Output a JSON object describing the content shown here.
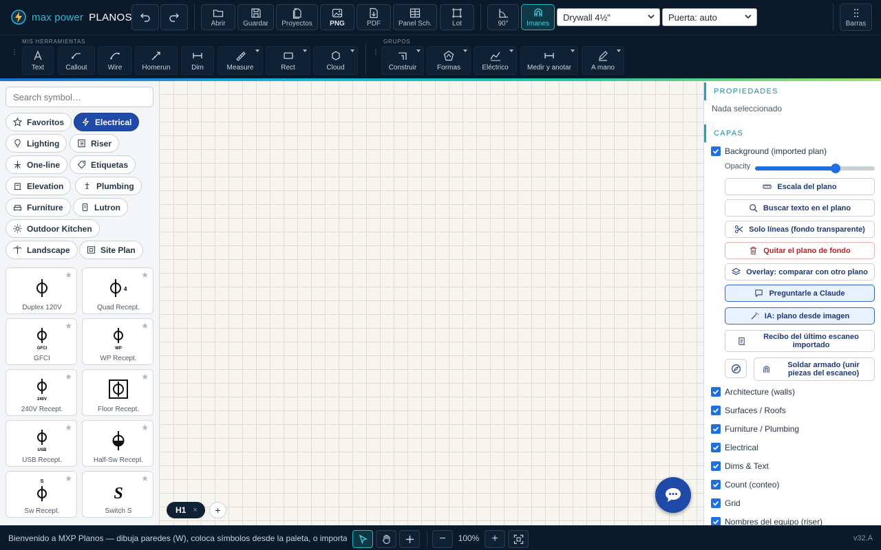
{
  "app": {
    "brand_primary": "max power",
    "brand_secondary": "PLANOS",
    "accent_color": "#1aa6bd",
    "primary_button_color": "#1f4aa8"
  },
  "topbar": {
    "undo_icon": "undo-icon",
    "redo_icon": "redo-icon",
    "file_buttons": [
      {
        "label": "Abrir",
        "icon": "folder-open-icon"
      },
      {
        "label": "Guardar",
        "icon": "save-icon"
      },
      {
        "label": "Proyectos",
        "icon": "projects-icon"
      },
      {
        "label": "PNG",
        "icon": "image-icon"
      },
      {
        "label": "PDF",
        "icon": "pdf-icon"
      },
      {
        "label": "Panel Sch.",
        "icon": "table-icon"
      },
      {
        "label": "Lot",
        "icon": "lot-icon"
      }
    ],
    "angle_button": {
      "label": "90°",
      "icon": "angle-icon"
    },
    "magnet_button": {
      "label": "Imanes",
      "icon": "magnet-icon",
      "active": true
    },
    "wall_type_select": "Drywall 4½\"",
    "door_select": "Puerta: auto",
    "toolbars_button": {
      "label": "Barras",
      "icon": "more-vertical-icon"
    }
  },
  "toolbar": {
    "my_tools_title": "MIS HERRAMIENTAS",
    "groups_title": "GRUPOS",
    "my_tools": [
      {
        "label": "Text",
        "icon": "text-icon",
        "dropdown": false
      },
      {
        "label": "Callout",
        "icon": "callout-icon",
        "dropdown": false
      },
      {
        "label": "Wire",
        "icon": "wire-icon",
        "dropdown": false
      },
      {
        "label": "Homerun",
        "icon": "homerun-icon",
        "dropdown": false
      },
      {
        "label": "Dim",
        "icon": "dimension-icon",
        "dropdown": false
      },
      {
        "label": "Measure",
        "icon": "measure-icon",
        "dropdown": true
      },
      {
        "label": "Rect",
        "icon": "rectangle-icon",
        "dropdown": true
      },
      {
        "label": "Cloud",
        "icon": "cloud-icon",
        "dropdown": true
      }
    ],
    "groups": [
      {
        "label": "Construir",
        "icon": "construct-icon",
        "dropdown": true
      },
      {
        "label": "Formas",
        "icon": "shapes-icon",
        "dropdown": true
      },
      {
        "label": "Eléctrico",
        "icon": "electrical-icon",
        "dropdown": true
      },
      {
        "label": "Medir y anotar",
        "icon": "measure-annotate-icon",
        "dropdown": true
      },
      {
        "label": "A mano",
        "icon": "pen-icon",
        "dropdown": true
      }
    ]
  },
  "palette": {
    "search_placeholder": "Search symbol…",
    "categories": [
      {
        "label": "Favoritos",
        "icon": "star-icon",
        "active": false
      },
      {
        "label": "Electrical",
        "icon": "bolt-icon",
        "active": true
      },
      {
        "label": "Lighting",
        "icon": "bulb-icon",
        "active": false
      },
      {
        "label": "Riser",
        "icon": "riser-icon",
        "active": false
      },
      {
        "label": "One-line",
        "icon": "one-line-icon",
        "active": false
      },
      {
        "label": "Etiquetas",
        "icon": "tag-icon",
        "active": false
      },
      {
        "label": "Elevation",
        "icon": "elevation-icon",
        "active": false
      },
      {
        "label": "Plumbing",
        "icon": "plumbing-icon",
        "active": false
      },
      {
        "label": "Furniture",
        "icon": "sofa-icon",
        "active": false
      },
      {
        "label": "Lutron",
        "icon": "lutron-icon",
        "active": false
      },
      {
        "label": "Outdoor Kitchen",
        "icon": "sun-icon",
        "active": false
      },
      {
        "label": "Landscape",
        "icon": "palm-icon",
        "active": false
      },
      {
        "label": "Site Plan",
        "icon": "site-plan-icon",
        "active": false
      }
    ],
    "symbols": [
      {
        "name": "Duplex 120V",
        "symbol_text": ""
      },
      {
        "name": "Quad Recept.",
        "symbol_text": "4"
      },
      {
        "name": "GFCI",
        "symbol_text": "GFCI"
      },
      {
        "name": "WP Recept.",
        "symbol_text": "WP"
      },
      {
        "name": "240V Recept.",
        "symbol_text": "240V"
      },
      {
        "name": "Floor Recept.",
        "symbol_text": ""
      },
      {
        "name": "USB Recept.",
        "symbol_text": "USB"
      },
      {
        "name": "Half-Sw Recept.",
        "symbol_text": ""
      },
      {
        "name": "Sw Recept.",
        "symbol_text": "S"
      },
      {
        "name": "Switch S",
        "symbol_text": "S"
      }
    ]
  },
  "canvas": {
    "sheet_tab": "H1",
    "sheet_close": "×",
    "add_sheet": "+"
  },
  "properties": {
    "title": "PROPIEDADES",
    "empty_text": "Nada seleccionado"
  },
  "layers": {
    "title": "CAPAS",
    "background_layer": {
      "label": "Background (imported plan)",
      "checked": true
    },
    "opacity_label": "Opacity",
    "opacity_value": 0.67,
    "background_actions": [
      {
        "label": "Escala del plano",
        "icon": "ruler-icon",
        "style": "normal"
      },
      {
        "label": "Buscar texto en el plano",
        "icon": "search-icon",
        "style": "normal"
      },
      {
        "label": "Solo líneas (fondo transparente)",
        "icon": "scissors-icon",
        "style": "normal"
      },
      {
        "label": "Quitar el plano de fondo",
        "icon": "trash-icon",
        "style": "danger"
      },
      {
        "label": "Overlay: comparar con otro plano",
        "icon": "layers-icon",
        "style": "normal"
      },
      {
        "label": "Preguntarle a Claude",
        "icon": "chat-icon",
        "style": "highlight"
      },
      {
        "label": "IA: plano desde imagen",
        "icon": "wand-icon",
        "style": "highlight"
      }
    ],
    "receipt_button": {
      "label": "Recibo del último escaneo importado",
      "icon": "receipt-icon"
    },
    "compass_button_icon": "compass-icon",
    "weld_button": {
      "label": "Soldar armado (unir piezas del escaneo)",
      "icon": "magnet-icon"
    },
    "layer_list": [
      {
        "label": "Architecture (walls)",
        "checked": true
      },
      {
        "label": "Surfaces / Roofs",
        "checked": true
      },
      {
        "label": "Furniture / Plumbing",
        "checked": true
      },
      {
        "label": "Electrical",
        "checked": true
      },
      {
        "label": "Dims & Text",
        "checked": true
      },
      {
        "label": "Count (conteo)",
        "checked": true
      },
      {
        "label": "Grid",
        "checked": true
      },
      {
        "label": "Nombres del equipo (riser)",
        "checked": true
      }
    ]
  },
  "statusbar": {
    "message": "Bienvenido a MXP Planos — dibuja paredes (W), coloca símbolos desde la paleta, o importa un plano",
    "select_tool_icon": "pointer-icon",
    "pan_tool_icon": "hand-icon",
    "add_tool_icon": "plus-icon",
    "zoom_out": "−",
    "zoom_level": "100%",
    "zoom_in": "+",
    "fit_icon": "fit-screen-icon",
    "version": "v32.A"
  },
  "chat_fab_icon": "chat-bubble-icon"
}
